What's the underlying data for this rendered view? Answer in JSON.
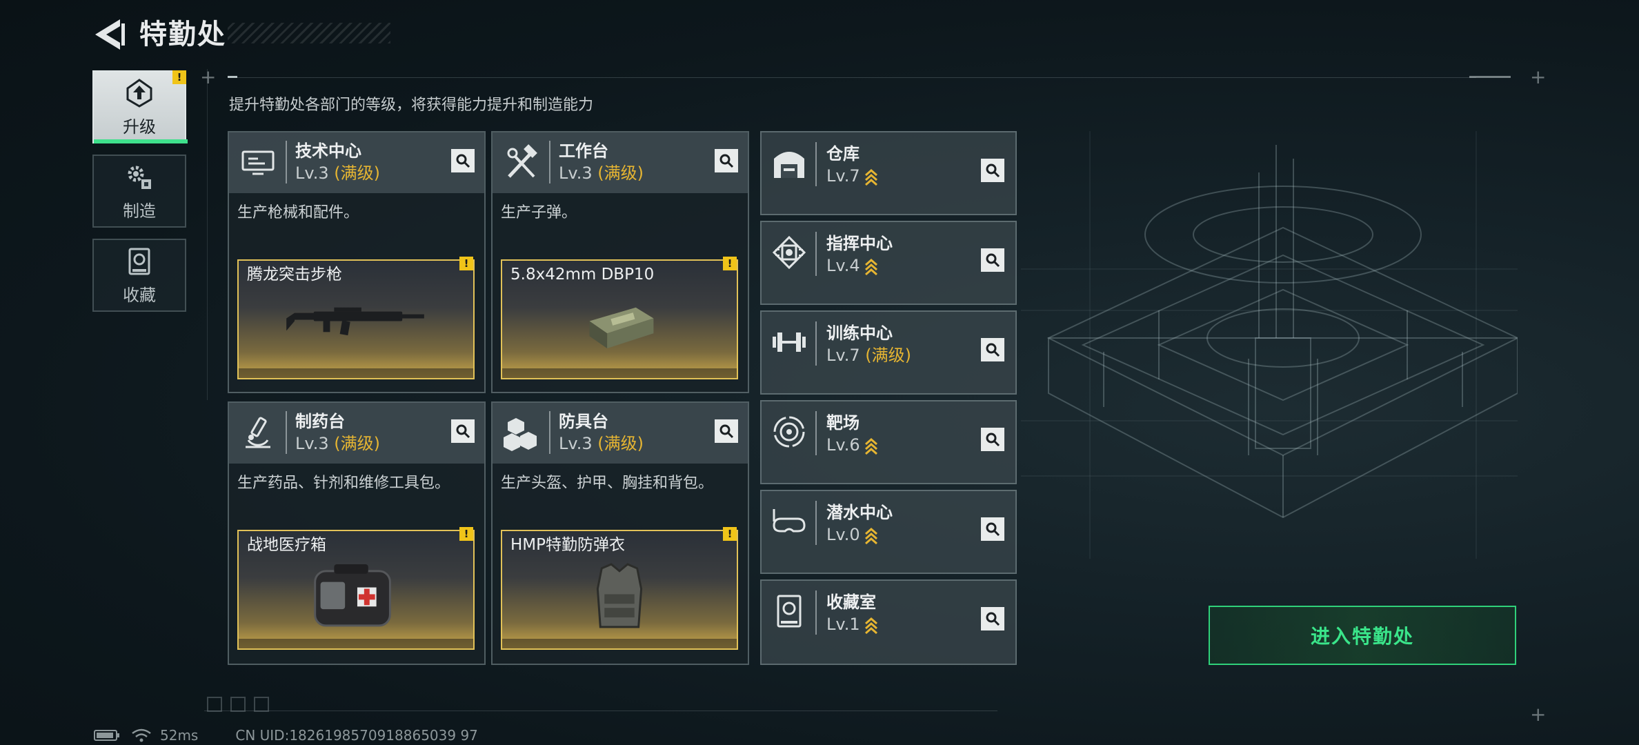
{
  "header": {
    "title": "特勤处"
  },
  "nav": [
    {
      "label": "升级",
      "icon": "upgrade-icon",
      "active": true,
      "badge": "!"
    },
    {
      "label": "制造",
      "icon": "gears-icon",
      "active": false
    },
    {
      "label": "收藏",
      "icon": "collection-icon",
      "active": false
    }
  ],
  "subtitle": "提升特勤处各部门的等级，将获得能力提升和制造能力",
  "facilities": [
    {
      "name": "技术中心",
      "level": "Lv.3",
      "max": "(满级)",
      "desc": "生产枪械和配件。",
      "item": "腾龙突击步枪",
      "icon": "monitor-icon",
      "badge": "!"
    },
    {
      "name": "工作台",
      "level": "Lv.3",
      "max": "(满级)",
      "desc": "生产子弹。",
      "item": "5.8x42mm DBP10",
      "icon": "tools-icon",
      "badge": "!"
    },
    {
      "name": "制药台",
      "level": "Lv.3",
      "max": "(满级)",
      "desc": "生产药品、针剂和维修工具包。",
      "item": "战地医疗箱",
      "icon": "microscope-icon",
      "badge": "!"
    },
    {
      "name": "防具台",
      "level": "Lv.3",
      "max": "(满级)",
      "desc": "生产头盔、护甲、胸挂和背包。",
      "item": "HMP特勤防弹衣",
      "icon": "armor-icon",
      "badge": "!"
    }
  ],
  "departments": [
    {
      "name": "仓库",
      "level": "Lv.7",
      "max": "",
      "icon": "warehouse-icon",
      "upgradable": true
    },
    {
      "name": "指挥中心",
      "level": "Lv.4",
      "max": "",
      "icon": "chip-icon",
      "upgradable": true
    },
    {
      "name": "训练中心",
      "level": "Lv.7",
      "max": "(满级)",
      "icon": "dumbbell-icon",
      "upgradable": false
    },
    {
      "name": "靶场",
      "level": "Lv.6",
      "max": "",
      "icon": "target-icon",
      "upgradable": true
    },
    {
      "name": "潜水中心",
      "level": "Lv.0",
      "max": "",
      "icon": "diving-mask-icon",
      "upgradable": true
    },
    {
      "name": "收藏室",
      "level": "Lv.1",
      "max": "",
      "icon": "collection-icon",
      "upgradable": true
    }
  ],
  "enter_button": "进入特勤处",
  "footer": {
    "ping": "52ms",
    "uid": "CN UID:1826198570918865039 97"
  },
  "colors": {
    "accent_green": "#3ae58a",
    "max_gold": "#e6b532",
    "badge_yellow": "#f0c419"
  }
}
